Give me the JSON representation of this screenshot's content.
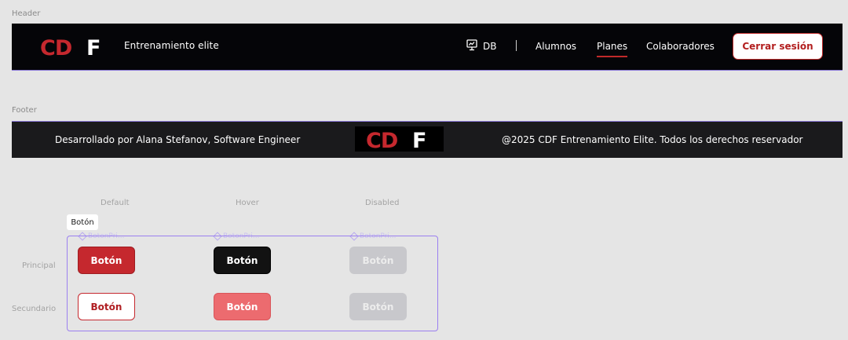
{
  "frames": {
    "header_label": "Header",
    "footer_label": "Footer"
  },
  "header": {
    "logo_text": "CDF",
    "brand": "Entrenamiento elite",
    "nav": {
      "db_label": "DB",
      "db_icon": "presentation-chart-icon",
      "items": [
        {
          "label": "Alumnos",
          "active": false
        },
        {
          "label": "Planes",
          "active": true
        },
        {
          "label": "Colaboradores",
          "active": false
        }
      ]
    },
    "logout_label": "Cerrar sesión"
  },
  "footer": {
    "credit": "Desarrollado por Alana Stefanov, Software Engineer",
    "logo_text": "CDF",
    "copyright": "@2025 CDF Entrenamiento Elite. Todos los derechos reservador"
  },
  "buttons": {
    "states": [
      "Default",
      "Hover",
      "Disabled"
    ],
    "variants": [
      "Principal",
      "Secundario"
    ],
    "tooltip": "Botón",
    "component_tag": "BotonPri...",
    "label": "Botón"
  },
  "colors": {
    "brand_red": "#c5282e",
    "header_bg": "#050508",
    "footer_bg": "#1a1a1c",
    "hover_dark": "#121212",
    "hover_light_red": "#ec6b6f",
    "disabled_gray": "#c8c8cc",
    "selection_purple": "#9b7ff0"
  }
}
